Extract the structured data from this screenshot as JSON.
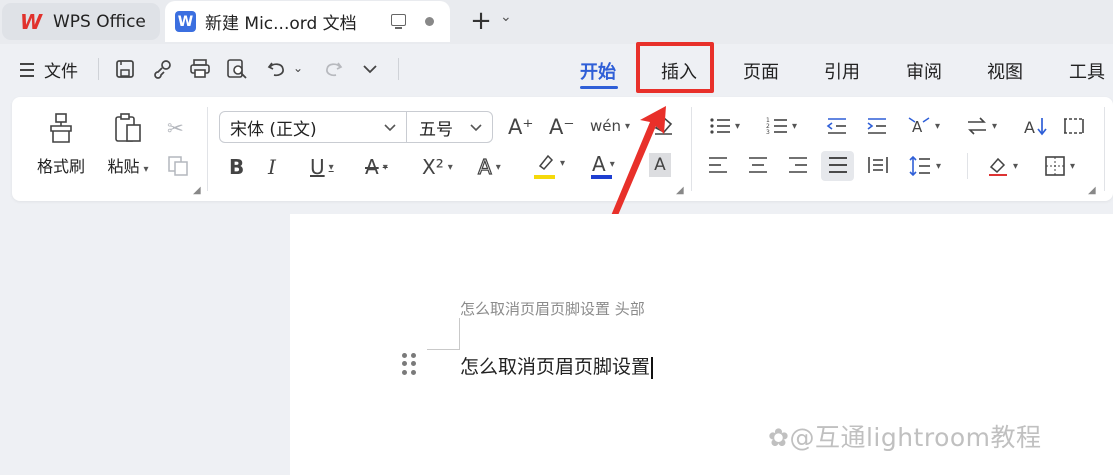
{
  "titlebar": {
    "home_tab": "WPS Office",
    "logo_mark": "W",
    "doc_tab_icon": "W",
    "doc_tab_title": "新建 Mic...ord 文档",
    "new_tab_symbol": "+",
    "chevron": "⌄"
  },
  "menubar": {
    "file_label": "文件",
    "ribbon_tabs": [
      "开始",
      "插入",
      "页面",
      "引用",
      "审阅",
      "视图",
      "工具"
    ],
    "active_tab": "开始",
    "highlighted_tab": "插入",
    "highlight_color": "#e8302a",
    "accent_color": "#2f5fd7"
  },
  "ribbon": {
    "format_painter": "格式刷",
    "paste": "粘贴",
    "font_name": "宋体 (正文)",
    "font_size": "五号",
    "grow_font": "A⁺",
    "shrink_font": "A⁻",
    "phonetic": "wén",
    "bold": "B",
    "italic": "I",
    "underline": "U",
    "strike": "A",
    "superscript": "X²",
    "text_effect": "A",
    "font_color": "A",
    "char_shade": "A",
    "highlight_color": "#f5d90a",
    "font_color_value": "#1f3fd1"
  },
  "document": {
    "header_text": "怎么取消页眉页脚设置 头部",
    "body_text": "怎么取消页眉页脚设置"
  },
  "watermark": "@互通lightroom教程",
  "watermark_icon": "✿"
}
